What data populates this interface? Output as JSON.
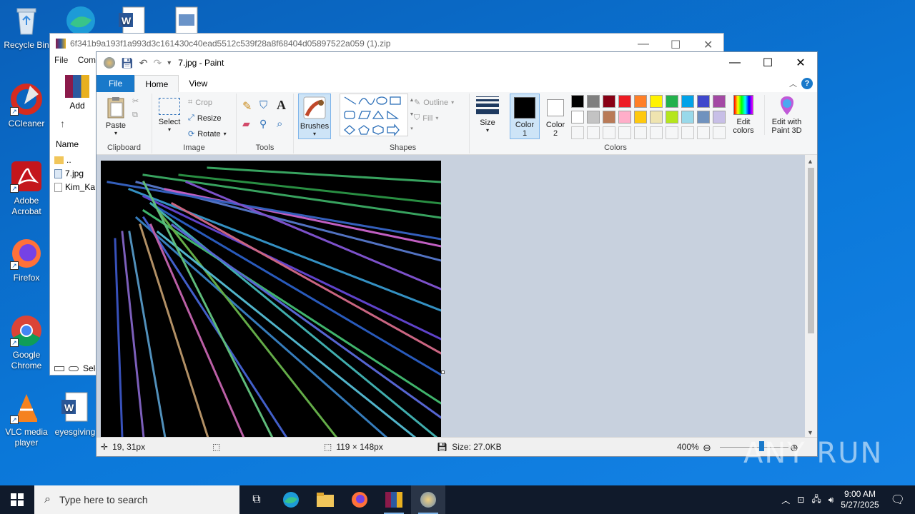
{
  "desktop": {
    "icons": [
      {
        "label": "Recycle Bin"
      },
      {
        "label": "CCleaner"
      },
      {
        "label": "Adobe Acrobat"
      },
      {
        "label": "Firefox"
      },
      {
        "label": "Google Chrome"
      },
      {
        "label": "VLC media player"
      },
      {
        "label": "eyesgiving"
      }
    ]
  },
  "winrar": {
    "title": "6f341b9a193f1a993d3c161430c40ead5512c539f28a8f68404d05897522a059 (1).zip",
    "menu_file": "File",
    "menu_com": "Com",
    "add_label": "Add",
    "col_name": "Name",
    "files": [
      "..",
      "7.jpg",
      "Kim_Ka"
    ],
    "status_sel": "Sele"
  },
  "paint": {
    "title": "7.jpg - Paint",
    "tabs": {
      "file": "File",
      "home": "Home",
      "view": "View"
    },
    "clipboard": {
      "paste": "Paste",
      "group": "Clipboard"
    },
    "image": {
      "select": "Select",
      "crop": "Crop",
      "resize": "Resize",
      "rotate": "Rotate",
      "group": "Image"
    },
    "tools": {
      "group": "Tools"
    },
    "brushes": {
      "label": "Brushes"
    },
    "shapes": {
      "outline": "Outline",
      "fill": "Fill",
      "group": "Shapes"
    },
    "size": {
      "label": "Size"
    },
    "color1": {
      "label": "Color 1",
      "line1": "Color",
      "line2": "1",
      "value": "#000000"
    },
    "color2": {
      "label": "Color 2",
      "line1": "Color",
      "line2": "2",
      "value": "#ffffff"
    },
    "colors": {
      "group": "Colors",
      "palette_row1": [
        "#000000",
        "#7f7f7f",
        "#880015",
        "#ed1c24",
        "#ff7f27",
        "#fff200",
        "#22b14c",
        "#00a2e8",
        "#3f48cc",
        "#a349a4"
      ],
      "palette_row2": [
        "#ffffff",
        "#c3c3c3",
        "#b97a57",
        "#ffaec9",
        "#ffc90e",
        "#efe4b0",
        "#b5e61d",
        "#99d9ea",
        "#7092be",
        "#c8bfe7"
      ],
      "edit_colors_line1": "Edit",
      "edit_colors_line2": "colors"
    },
    "edit3d": {
      "line1": "Edit with",
      "line2": "Paint 3D"
    },
    "status": {
      "cursor_pos": "19, 31px",
      "dimensions": "119 × 148px",
      "size": "Size: 27.0KB",
      "zoom": "400%",
      "zoom_level": 0.6
    }
  },
  "taskbar": {
    "search_placeholder": "Type here to search",
    "time": "9:00 AM",
    "date": "5/27/2025"
  },
  "watermark": "ANY RUN"
}
